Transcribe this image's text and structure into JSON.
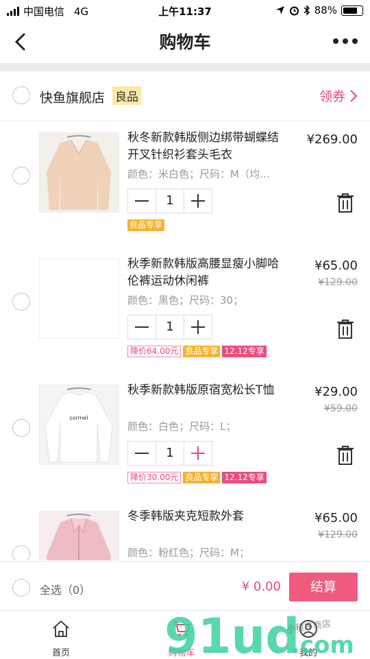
{
  "status_bar": {
    "carrier": "中国电信",
    "network": "4G",
    "time": "上午11:37",
    "battery": "88%",
    "battery_level": 0.88
  },
  "header": {
    "title": "购物车"
  },
  "store": {
    "name": "快鱼旗舰店",
    "tag": "良品",
    "coupon_label": "领券"
  },
  "items": [
    {
      "name": "秋冬新款韩版侧边绑带蝴蝶结开叉针织衫套头毛衣",
      "spec": "颜色：米白色；尺码：M（均…",
      "price": "¥269.00",
      "old_price": "",
      "quantity": "1",
      "badges": [
        {
          "type": "good",
          "text": "良品专享"
        }
      ]
    },
    {
      "name": "秋季新款韩版高腰显瘦小脚哈伦裤运动休闲裤",
      "spec": "颜色：黑色；尺码：30；",
      "price": "¥65.00",
      "old_price": "¥129.00",
      "quantity": "1",
      "badges": [
        {
          "type": "drop",
          "text": "降价64.00元"
        },
        {
          "type": "good",
          "text": "良品专享"
        },
        {
          "type": "d12",
          "text": "12.12专享"
        }
      ]
    },
    {
      "name": "秋季新款韩版原宿宽松长T恤",
      "spec": "颜色：白色；尺码：L；",
      "price": "¥29.00",
      "old_price": "¥59.00",
      "quantity": "1",
      "badges": [
        {
          "type": "drop",
          "text": "降价30.00元"
        },
        {
          "type": "good",
          "text": "良品专享"
        },
        {
          "type": "d12",
          "text": "12.12专享"
        }
      ]
    },
    {
      "name": "冬季韩版夹克短款外套",
      "spec": "颜色：粉红色；尺码：M；",
      "price": "¥65.00",
      "old_price": "¥129.00",
      "quantity": "1",
      "badges": []
    }
  ],
  "tshirt_print": "sormel",
  "footer": {
    "select_all": "全选（0）",
    "total": "¥ 0.00",
    "checkout": "结算"
  },
  "tabs": [
    {
      "label": "首页"
    },
    {
      "label": "购物车"
    },
    {
      "label": "我的"
    }
  ],
  "watermark": {
    "text": "91ud",
    "domain": ".com",
    "subtitle": "小程序商店"
  },
  "colors": {
    "accent": "#e8467c",
    "checkout": "#ef5a7e",
    "good_badge": "#f4b333",
    "watermark": "#3ad29f"
  }
}
